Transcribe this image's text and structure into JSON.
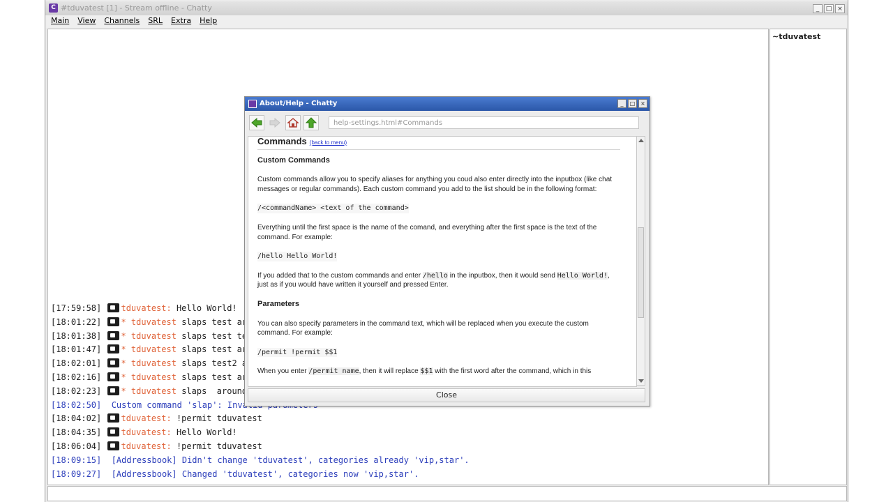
{
  "window": {
    "title": "#tduvatest [1] - Stream offline - Chatty",
    "controls": [
      "_",
      "□",
      "×"
    ]
  },
  "menu": [
    "Main",
    "View",
    "Channels",
    "SRL",
    "Extra",
    "Help"
  ],
  "userlist": [
    "~tduvatest"
  ],
  "chat": [
    {
      "ts": "[17:59:58]",
      "badge": true,
      "nick": "tduvatest:",
      "action": false,
      "text": " Hello World!"
    },
    {
      "ts": "[18:01:22]",
      "badge": true,
      "nick": "* tduvatest",
      "action": true,
      "text": " slaps test ar"
    },
    {
      "ts": "[18:01:38]",
      "badge": true,
      "nick": "* tduvatest",
      "action": true,
      "text": " slaps test te"
    },
    {
      "ts": "[18:01:47]",
      "badge": true,
      "nick": "* tduvatest",
      "action": true,
      "text": " slaps test ar"
    },
    {
      "ts": "[18:02:01]",
      "badge": true,
      "nick": "* tduvatest",
      "action": true,
      "text": " slaps test2 a"
    },
    {
      "ts": "[18:02:16]",
      "badge": true,
      "nick": "* tduvatest",
      "action": true,
      "text": " slaps test ar"
    },
    {
      "ts": "[18:02:23]",
      "badge": true,
      "nick": "* tduvatest",
      "action": true,
      "text": " slaps  around"
    },
    {
      "ts": "[18:02:50]",
      "badge": false,
      "info": true,
      "text": " Custom command 'slap': Invalid parameters"
    },
    {
      "ts": "[18:04:02]",
      "badge": true,
      "nick": "tduvatest:",
      "action": false,
      "text": " !permit tduvatest"
    },
    {
      "ts": "[18:04:35]",
      "badge": true,
      "nick": "tduvatest:",
      "action": false,
      "text": " Hello World!"
    },
    {
      "ts": "[18:06:04]",
      "badge": true,
      "nick": "tduvatest:",
      "action": false,
      "text": " !permit tduvatest"
    },
    {
      "ts": "[18:09:15]",
      "badge": false,
      "info": true,
      "text": " [Addressbook] Didn't change 'tduvatest', categories already 'vip,star'."
    },
    {
      "ts": "[18:09:27]",
      "badge": false,
      "info": true,
      "text": " [Addressbook] Changed 'tduvatest', categories now 'vip,star'."
    }
  ],
  "dialog": {
    "title": "About/Help - Chatty",
    "url": "help-settings.html#Commands",
    "close_label": "Close",
    "heading": "Commands",
    "back_link": "(back to menu)",
    "sub1": "Custom Commands",
    "p1": "Custom commands allow you to specify aliases for anything you coud also enter directly into the inputbox (like chat messages or regular commands). Each custom command you add to the list should be in the following format:",
    "code1": "/<commandName> <text of the command>",
    "p2": "Everything until the first space is the name of the comand, and everything after the first space is the text of the command. For example:",
    "code2": "/hello Hello World!",
    "p3a": "If you added that to the custom commands and enter ",
    "p3code1": "/hello",
    "p3b": " in the inputbox, then it would send ",
    "p3code2": "Hello World!",
    "p3c": ", just as if you would have written it yourself and pressed Enter.",
    "sub2": "Parameters",
    "p4": "You can also specify parameters in the command text, which will be replaced when you execute the custom command. For example:",
    "code3": "/permit !permit $$1",
    "p5a": "When you enter ",
    "p5code1": "/permit name",
    "p5b": ", then it will replace ",
    "p5code2": "$$1",
    "p5c": " with the first word after the command, which in this"
  },
  "colors": {
    "nick": "#e0643a",
    "info": "#2d3fbb",
    "dialog_title": "#2b57a8",
    "link": "#2233cc"
  }
}
